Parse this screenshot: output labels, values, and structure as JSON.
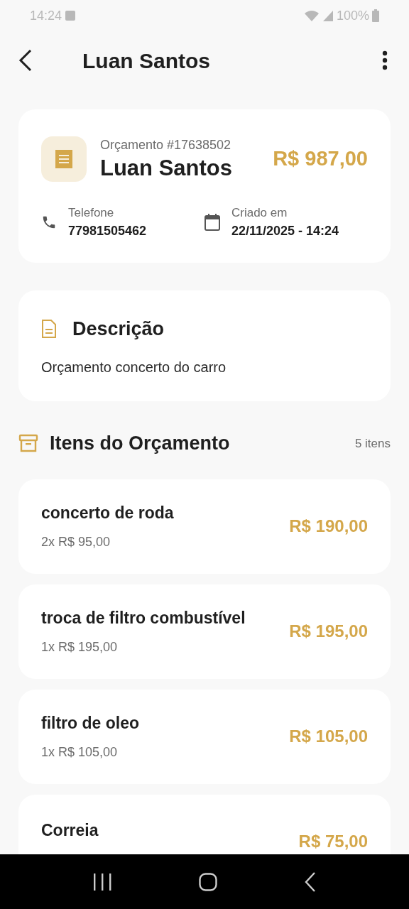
{
  "status_bar": {
    "time": "14:24",
    "battery": "100%"
  },
  "header": {
    "title": "Luan Santos"
  },
  "summary": {
    "number": "Orçamento #17638502",
    "client": "Luan Santos",
    "total": "R$ 987,00",
    "phone_label": "Telefone",
    "phone": "77981505462",
    "created_label": "Criado em",
    "created": "22/11/2025 - 14:24"
  },
  "description": {
    "title": "Descrição",
    "text": "Orçamento concerto do carro"
  },
  "items_section": {
    "title": "Itens do Orçamento",
    "count": "5 itens"
  },
  "items": [
    {
      "name": "concerto de roda",
      "detail": "2x R$ 95,00",
      "total": "R$ 190,00"
    },
    {
      "name": "troca de filtro combustível",
      "detail": "1x R$ 195,00",
      "total": "R$ 195,00"
    },
    {
      "name": "filtro de oleo",
      "detail": "1x R$ 105,00",
      "total": "R$ 105,00"
    },
    {
      "name": "Correia",
      "total": "R$ 75,00"
    }
  ]
}
